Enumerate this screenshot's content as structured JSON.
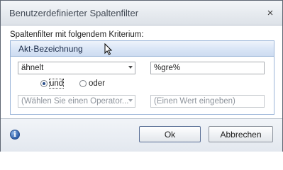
{
  "window": {
    "title": "Benutzerdefinierter Spaltenfilter",
    "close_glyph": "×"
  },
  "criteria_label": "Spaltenfilter mit folgendem Kriterium:",
  "group": {
    "title": "Akt-Bezeichnung"
  },
  "condition1": {
    "operator": "ähnelt",
    "value": "%gre%"
  },
  "logic": {
    "and_label": "und",
    "or_label": "oder",
    "selected": "und"
  },
  "condition2": {
    "operator_placeholder": "(Wählen Sie einen Operator...",
    "value_placeholder": "(Einen Wert eingeben)"
  },
  "footer": {
    "info_icon": "info-icon",
    "ok_label": "Ok",
    "cancel_label": "Abbrechen"
  },
  "colors": {
    "accent": "#2f5fa8",
    "group_header": "#d9e5f6",
    "group_border": "#9bb5d8"
  }
}
